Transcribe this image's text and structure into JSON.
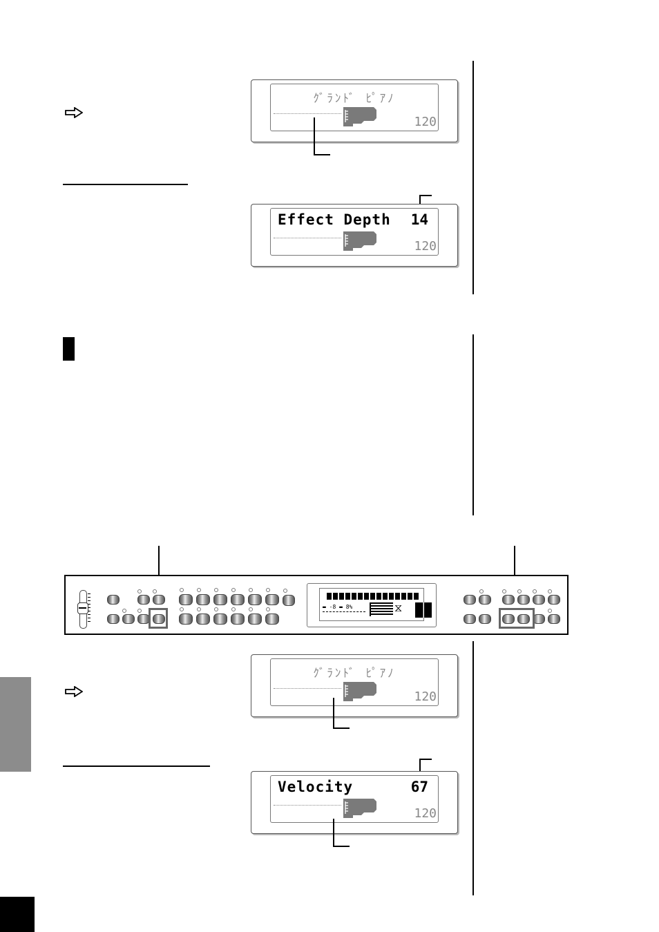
{
  "displays": {
    "voice_display_1": {
      "top_line": "ｸﾞﾗﾝﾄﾞ ﾋﾟｱﾉ",
      "tempo": "120"
    },
    "effect_depth_display": {
      "param_label": "Effect Depth",
      "param_value": "14",
      "tempo": "120"
    },
    "voice_display_2": {
      "top_line": "ｸﾞﾗﾝﾄﾞ ﾋﾟｱﾉ",
      "tempo": "120"
    },
    "velocity_display": {
      "param_label": "Velocity",
      "param_value": "67",
      "tempo": "120"
    }
  },
  "icons": {
    "arrow_1": "hollow-right-arrow",
    "arrow_2": "hollow-right-arrow",
    "section_marker": "black-bar",
    "piano_icon": "grand-piano-silhouette"
  },
  "panel": {
    "name": "instrument-control-panel",
    "lcd_segments": 15,
    "highlighted_controls": [
      "left-group-button",
      "down-up-rewind-forward-buttons"
    ]
  },
  "colors": {
    "side_tab": "#8c8c8c",
    "page_block": "#000000",
    "lcd_dim_text": "#888888"
  }
}
